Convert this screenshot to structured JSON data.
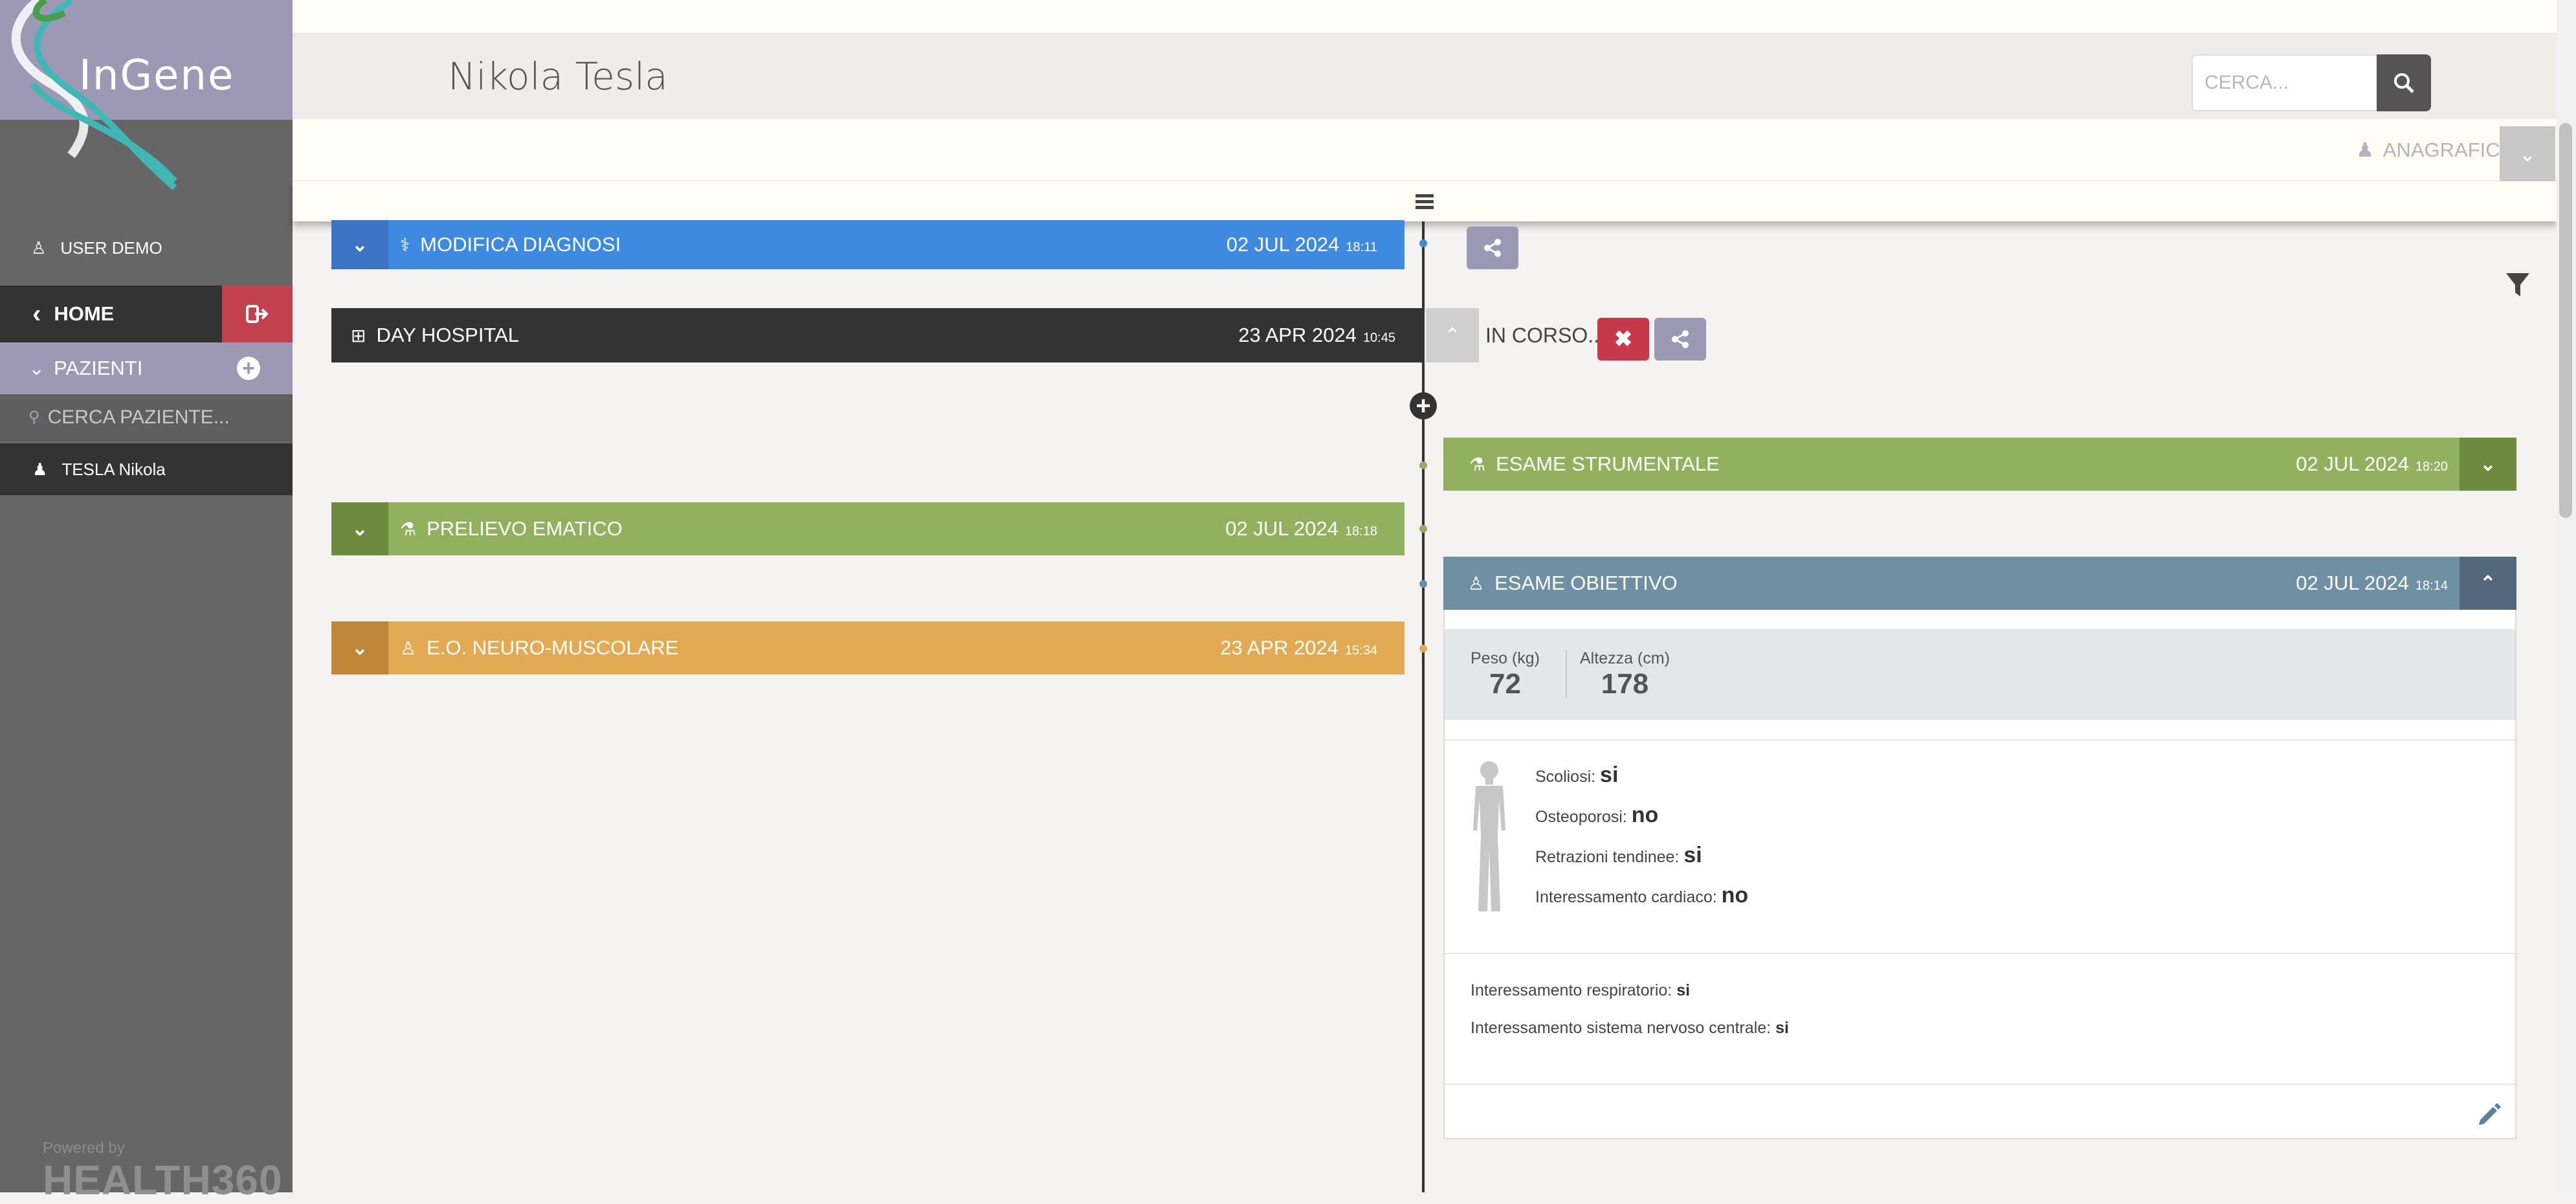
{
  "app": {
    "logo_text": "InGene",
    "powered_by": "Powered by",
    "powered_brand": "HEALTH360"
  },
  "sidebar": {
    "user": "USER DEMO",
    "home": "HOME",
    "patients_section": "PAZIENTI",
    "search_placeholder": "CERCA PAZIENTE...",
    "patient": "TESLA Nikola"
  },
  "header": {
    "patient_name": "Nikola Tesla",
    "search_placeholder": "CERCA...",
    "anagrafica": "ANAGRAFICA"
  },
  "timeline": {
    "modifica_diagnosi": {
      "title": "MODIFICA DIAGNOSI",
      "date": "02 JUL 2024",
      "time": "18:11"
    },
    "day_hospital": {
      "title": "DAY HOSPITAL",
      "date": "23 APR 2024",
      "time": "10:45",
      "status": "IN CORSO..."
    },
    "esame_strumentale": {
      "title": "ESAME STRUMENTALE",
      "date": "02 JUL 2024",
      "time": "18:20"
    },
    "prelievo_ematico": {
      "title": "PRELIEVO EMATICO",
      "date": "02 JUL 2024",
      "time": "18:18"
    },
    "esame_obiettivo": {
      "title": "ESAME OBIETTIVO",
      "date": "02 JUL 2024",
      "time": "18:14"
    },
    "eo_neuro": {
      "title": "E.O. NEURO-MUSCOLARE",
      "date": "23 APR 2024",
      "time": "15:34"
    }
  },
  "exam": {
    "measures": [
      {
        "label": "Peso (kg)",
        "value": "72"
      },
      {
        "label": "Altezza (cm)",
        "value": "178"
      }
    ],
    "questions": [
      {
        "label": "Scoliosi:",
        "value": "si"
      },
      {
        "label": "Osteoporosi:",
        "value": "no"
      },
      {
        "label": "Retrazioni tendinee:",
        "value": "si"
      },
      {
        "label": "Interessamento cardiaco:",
        "value": "no"
      },
      {
        "label": "Interessamento respiratorio:",
        "value": "si"
      },
      {
        "label": "Interessamento sistema nervoso centrale:",
        "value": "si"
      }
    ]
  },
  "colors": {
    "sidebar": "#666666",
    "accent_purple": "#9d99b4",
    "logout_red": "#c2414f",
    "blue": "#3e8ae0",
    "green": "#92b15f",
    "slate": "#6f8fa3",
    "orange": "#e3aa54",
    "dark": "#333333"
  }
}
